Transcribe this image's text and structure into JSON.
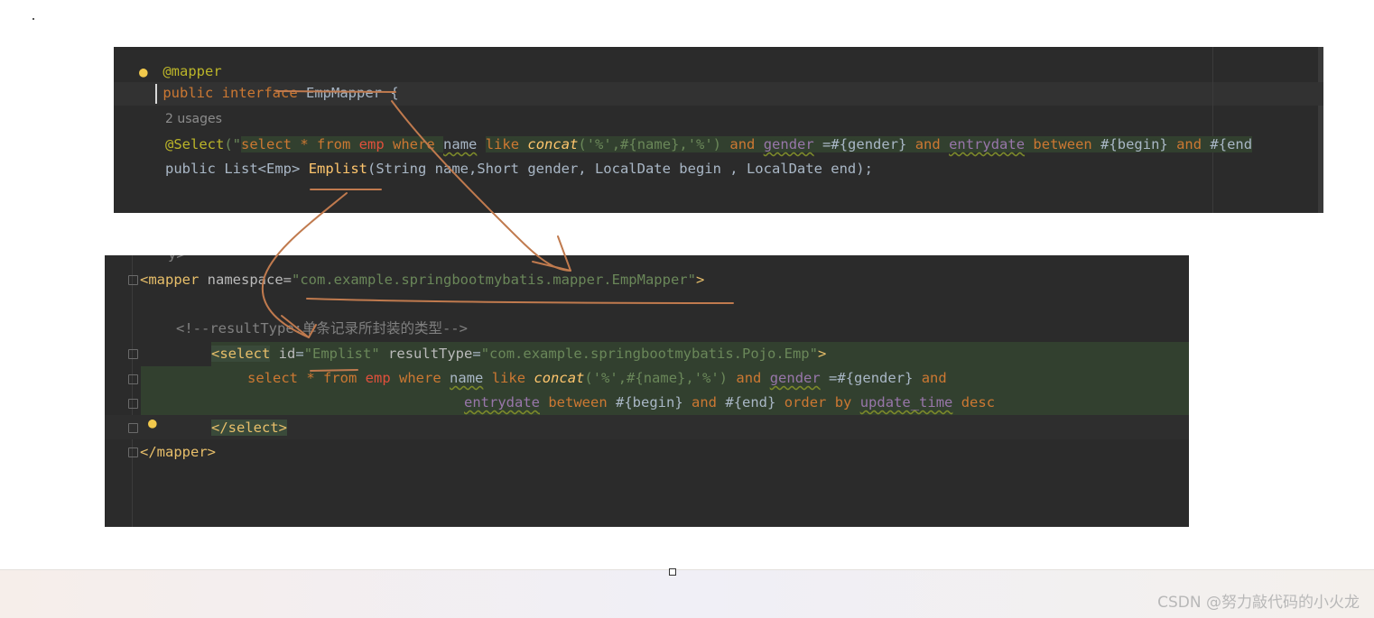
{
  "java": {
    "partial_top": "@mapper",
    "kw_public": "public",
    "kw_interface": "interface",
    "class_name": "EmpMapper",
    "brace_open": "{",
    "usages": "2 usages",
    "ann_select": "@Select",
    "paren_open": "(\"",
    "sql_select": "select * from",
    "sql_emp": "emp",
    "sql_where": "where",
    "sql_name": "name",
    "sql_like": "like",
    "sql_concat": "concat",
    "sql_args": "('%',#{name},'%')",
    "sql_and1": "and",
    "sql_gender": "gender",
    "sql_gender_val": "=#{gender}",
    "sql_and2": "and",
    "sql_entrydate": "entrydate",
    "sql_between": "between",
    "sql_begin": "#{begin}",
    "sql_and3": "and",
    "sql_tail": "#{end",
    "sig_public": "public",
    "sig_list": "List<Emp>",
    "sig_method": "Emplist",
    "sig_params": "(String name,Short gender, LocalDate begin , LocalDate end);"
  },
  "xml": {
    "partial_top": "y>",
    "mapper_open": "<mapper",
    "ns_attr": "namespace",
    "ns_eq": "=",
    "ns_value": "\"com.example.springbootmybatis.mapper.EmpMapper\"",
    "mapper_gt": ">",
    "comment": "<!--resultType:单条记录所封装的类型-->",
    "select_open": "<select",
    "id_attr": "id",
    "id_value": "\"Emplist\"",
    "rt_attr": "resultType",
    "rt_value": "\"com.example.springbootmybatis.Pojo.Emp\"",
    "select_gt": ">",
    "sql1_select": "select * from",
    "sql1_emp": "emp",
    "sql1_where": "where",
    "sql1_name": "name",
    "sql1_like": "like",
    "sql1_concat": "concat",
    "sql1_args": "('%',#{name},'%')",
    "sql1_and": "and",
    "sql1_gender": "gender",
    "sql1_gender_val": "=#{gender}",
    "sql1_and2": "and",
    "sql2_entrydate": "entrydate",
    "sql2_between": "between",
    "sql2_begin": "#{begin}",
    "sql2_and": "and",
    "sql2_end": "#{end}",
    "sql2_order": "order by",
    "sql2_update": "update_time",
    "sql2_desc": "desc",
    "select_close": "</select>",
    "mapper_close": "</mapper>"
  },
  "watermark": "CSDN @努力敲代码的小火龙",
  "colors": {
    "editor_bg": "#2b2b2b",
    "keyword": "#cc7832",
    "string": "#6a8759",
    "method": "#ffc66d",
    "annotation": "#bbb529",
    "xml_tag": "#e8bf6a",
    "field": "#9876aa",
    "pen_annotation": "#c07a4e"
  },
  "icons": [
    "lightbulb-icon",
    "fold-marker-icon",
    "caret"
  ]
}
